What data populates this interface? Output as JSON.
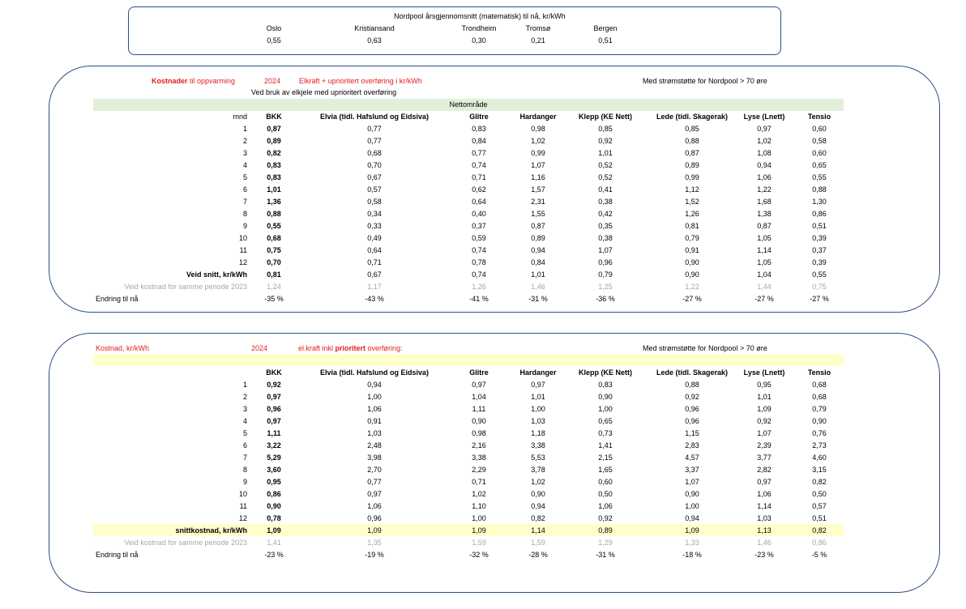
{
  "nordpool": {
    "title": "Nordpool årsgjennomsnitt (matematisk) til nå, kr/kWh",
    "regions": [
      {
        "name": "Oslo",
        "value": "0,55"
      },
      {
        "name": "Kristiansand",
        "value": "0,63"
      },
      {
        "name": "Trondheim",
        "value": "0,30"
      },
      {
        "name": "Tromsø",
        "value": "0,21"
      },
      {
        "name": "Bergen",
        "value": "0,51"
      }
    ]
  },
  "section1": {
    "title_bold": "Kostnader",
    "title_rest": " til oppvarming",
    "year": "2024",
    "subtitle": "Elkraft + uprioritert overføring i kr/kWh",
    "support": "Med strømstøtte for Nordpool > 70 øre",
    "note": "Ved bruk av elkjele med  uprioritert overføring",
    "band": "Nettområde",
    "month_header": "mnd",
    "columns": [
      "BKK",
      "Elvia (tidl. Hafslund og Eidsiva)",
      "Glitre",
      "Hardanger",
      "Klepp (KE Nett)",
      "Lede (tidl. Skagerak)",
      "Lyse (Lnett)",
      "Tensio"
    ],
    "rows": [
      {
        "label": "1",
        "values": [
          "0,87",
          "0,77",
          "0,83",
          "0,98",
          "0,85",
          "0,85",
          "0,97",
          "0,60"
        ]
      },
      {
        "label": "2",
        "values": [
          "0,89",
          "0,77",
          "0,84",
          "1,02",
          "0,92",
          "0,88",
          "1,02",
          "0,58"
        ]
      },
      {
        "label": "3",
        "values": [
          "0,82",
          "0,68",
          "0,77",
          "0,99",
          "1,01",
          "0,87",
          "1,08",
          "0,60"
        ]
      },
      {
        "label": "4",
        "values": [
          "0,83",
          "0,70",
          "0,74",
          "1,07",
          "0,52",
          "0,89",
          "0,94",
          "0,65"
        ]
      },
      {
        "label": "5",
        "values": [
          "0,83",
          "0,67",
          "0,71",
          "1,16",
          "0,52",
          "0,99",
          "1,06",
          "0,55"
        ]
      },
      {
        "label": "6",
        "values": [
          "1,01",
          "0,57",
          "0,62",
          "1,57",
          "0,41",
          "1,12",
          "1,22",
          "0,88"
        ]
      },
      {
        "label": "7",
        "values": [
          "1,36",
          "0,58",
          "0,64",
          "2,31",
          "0,38",
          "1,52",
          "1,68",
          "1,30"
        ]
      },
      {
        "label": "8",
        "values": [
          "0,88",
          "0,34",
          "0,40",
          "1,55",
          "0,42",
          "1,26",
          "1,38",
          "0,86"
        ]
      },
      {
        "label": "9",
        "values": [
          "0,55",
          "0,33",
          "0,37",
          "0,87",
          "0,35",
          "0,81",
          "0,87",
          "0,51"
        ]
      },
      {
        "label": "10",
        "values": [
          "0,68",
          "0,49",
          "0,59",
          "0,89",
          "0,38",
          "0,79",
          "1,05",
          "0,39"
        ]
      },
      {
        "label": "11",
        "values": [
          "0,75",
          "0,64",
          "0,74",
          "0,94",
          "1,07",
          "0,91",
          "1,14",
          "0,37"
        ]
      },
      {
        "label": "12",
        "values": [
          "0,70",
          "0,71",
          "0,78",
          "0,84",
          "0,96",
          "0,90",
          "1,05",
          "0,39"
        ]
      }
    ],
    "avg": {
      "label": "Veid snitt, kr/kWh",
      "values": [
        "0,81",
        "0,67",
        "0,74",
        "1,01",
        "0,79",
        "0,90",
        "1,04",
        "0,55"
      ]
    },
    "prev": {
      "label": "Veid kostnad for samme  periode 2023",
      "values": [
        "1,24",
        "1,17",
        "1,26",
        "1,46",
        "1,25",
        "1,22",
        "1,44",
        "0,75"
      ]
    },
    "change": {
      "label": "Endring til nå",
      "values": [
        "-35 %",
        "-43 %",
        "-41 %",
        "-31 %",
        "-36 %",
        "-27 %",
        "-27 %",
        "-27 %"
      ]
    }
  },
  "section2": {
    "title": "Kostnad, kr/kWh",
    "year": "2024",
    "subtitle_pre": "el.kraft  inkl  ",
    "subtitle_bold": "prioritert",
    "subtitle_post": " overføring:",
    "support": "Med strømstøtte for Nordpool > 70 øre",
    "columns": [
      "BKK",
      "Elvia (tidl. Hafslund og Eidsiva)",
      "Glitre",
      "Hardanger",
      "Klepp (KE Nett)",
      "Lede (tidl. Skagerak)",
      "Lyse (Lnett)",
      "Tensio"
    ],
    "rows": [
      {
        "label": "1",
        "values": [
          "0,92",
          "0,94",
          "0,97",
          "0,97",
          "0,83",
          "0,88",
          "0,95",
          "0,68"
        ]
      },
      {
        "label": "2",
        "values": [
          "0,97",
          "1,00",
          "1,04",
          "1,01",
          "0,90",
          "0,92",
          "1,01",
          "0,68"
        ]
      },
      {
        "label": "3",
        "values": [
          "0,96",
          "1,06",
          "1,11",
          "1,00",
          "1,00",
          "0,96",
          "1,09",
          "0,79"
        ]
      },
      {
        "label": "4",
        "values": [
          "0,97",
          "0,91",
          "0,90",
          "1,03",
          "0,65",
          "0,96",
          "0,92",
          "0,90"
        ]
      },
      {
        "label": "5",
        "values": [
          "1,11",
          "1,03",
          "0,98",
          "1,18",
          "0,73",
          "1,15",
          "1,07",
          "0,76"
        ]
      },
      {
        "label": "6",
        "values": [
          "3,22",
          "2,48",
          "2,16",
          "3,38",
          "1,41",
          "2,83",
          "2,39",
          "2,73"
        ]
      },
      {
        "label": "7",
        "values": [
          "5,29",
          "3,98",
          "3,38",
          "5,53",
          "2,15",
          "4,57",
          "3,77",
          "4,60"
        ]
      },
      {
        "label": "8",
        "values": [
          "3,60",
          "2,70",
          "2,29",
          "3,78",
          "1,65",
          "3,37",
          "2,82",
          "3,15"
        ]
      },
      {
        "label": "9",
        "values": [
          "0,95",
          "0,77",
          "0,71",
          "1,02",
          "0,60",
          "1,07",
          "0,97",
          "0,82"
        ]
      },
      {
        "label": "10",
        "values": [
          "0,86",
          "0,97",
          "1,02",
          "0,90",
          "0,50",
          "0,90",
          "1,06",
          "0,50"
        ]
      },
      {
        "label": "11",
        "values": [
          "0,90",
          "1,06",
          "1,10",
          "0,94",
          "1,06",
          "1,00",
          "1,14",
          "0,57"
        ]
      },
      {
        "label": "12",
        "values": [
          "0,78",
          "0,96",
          "1,00",
          "0,82",
          "0,92",
          "0,94",
          "1,03",
          "0,51"
        ]
      }
    ],
    "avg": {
      "label": "snittkostnad, kr/kWh",
      "values": [
        "1,09",
        "1,09",
        "1,09",
        "1,14",
        "0,89",
        "1,09",
        "1,13",
        "0,82"
      ]
    },
    "prev": {
      "label": "Veid kostnad for samme  periode 2023",
      "values": [
        "1,41",
        "1,35",
        "1,59",
        "1,59",
        "1,29",
        "1,33",
        "1,46",
        "0,86"
      ]
    },
    "change": {
      "label": "Endring til nå",
      "values": [
        "-23 %",
        "-19 %",
        "-32 %",
        "-28 %",
        "-31 %",
        "-18 %",
        "-23 %",
        "-5 %"
      ]
    }
  }
}
